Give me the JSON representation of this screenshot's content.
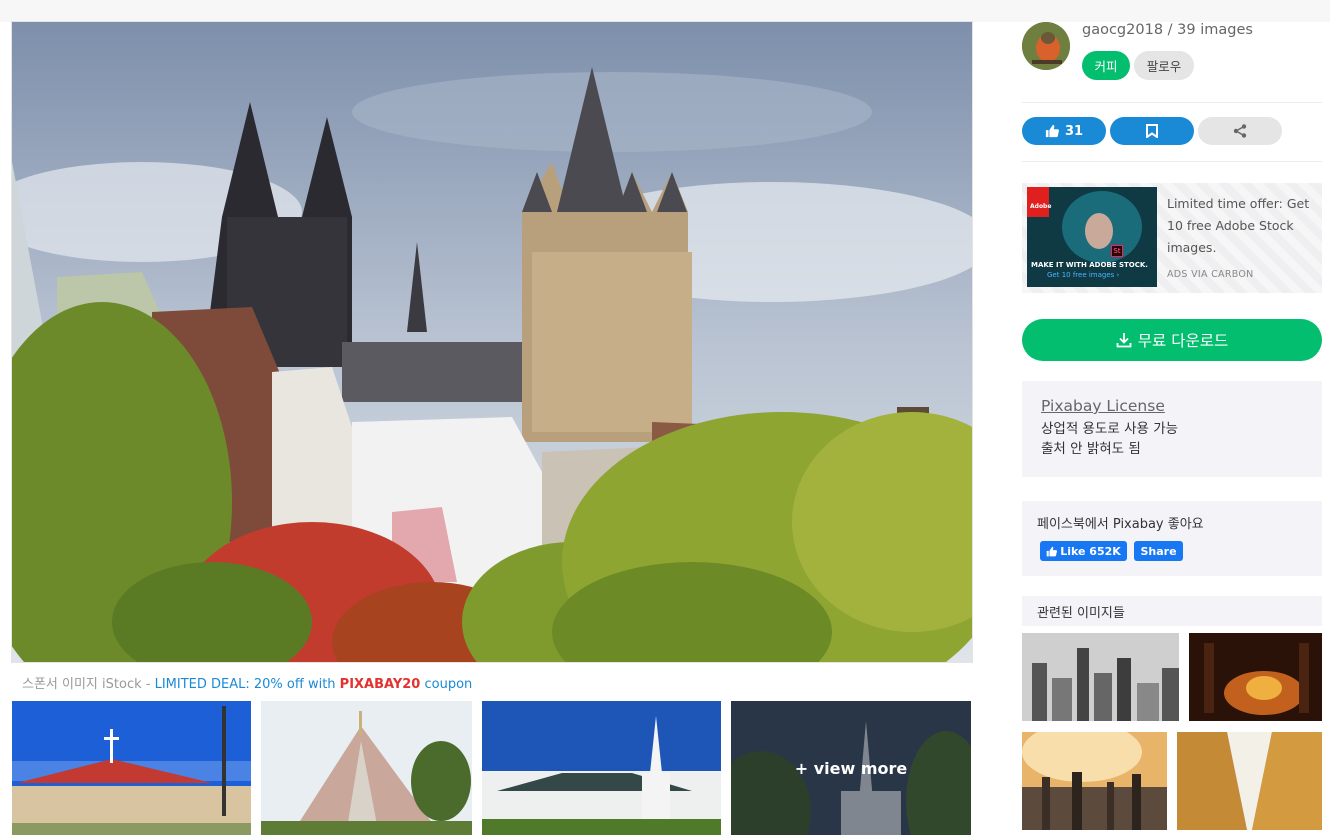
{
  "sponsor": {
    "prefix": "스폰서 이미지 iStock - ",
    "deal": "LIMITED DEAL: 20% off with ",
    "code": "PIXABAY20",
    "suffix": " coupon"
  },
  "thumbs": {
    "view_more": "+ view more"
  },
  "author": {
    "name": "gaocg2018 / 39 images",
    "coffee_label": "커피",
    "follow_label": "팔로우"
  },
  "actions": {
    "like_count": "31"
  },
  "ad": {
    "text": "Limited time offer: Get 10 free Adobe Stock images.",
    "via": "ADS VIA CARBON",
    "brand": "Adobe",
    "tagline": "MAKE IT WITH ADOBE STOCK.",
    "cta": "Get 10 free images ›",
    "app_badge": "St"
  },
  "download": {
    "label": "무료 다운로드"
  },
  "license": {
    "title": "Pixabay License",
    "line1": "상업적 용도로 사용 가능",
    "line2": "출처 안 밝혀도 됨"
  },
  "facebook": {
    "text": "페이스북에서 Pixabay 좋아요",
    "like_label": "Like 652K",
    "share_label": "Share"
  },
  "related": {
    "heading": "관련된 이미지들"
  },
  "colors": {
    "green": "#02be6e",
    "blue": "#1a8ad6",
    "coupon_red": "#e4322f"
  }
}
